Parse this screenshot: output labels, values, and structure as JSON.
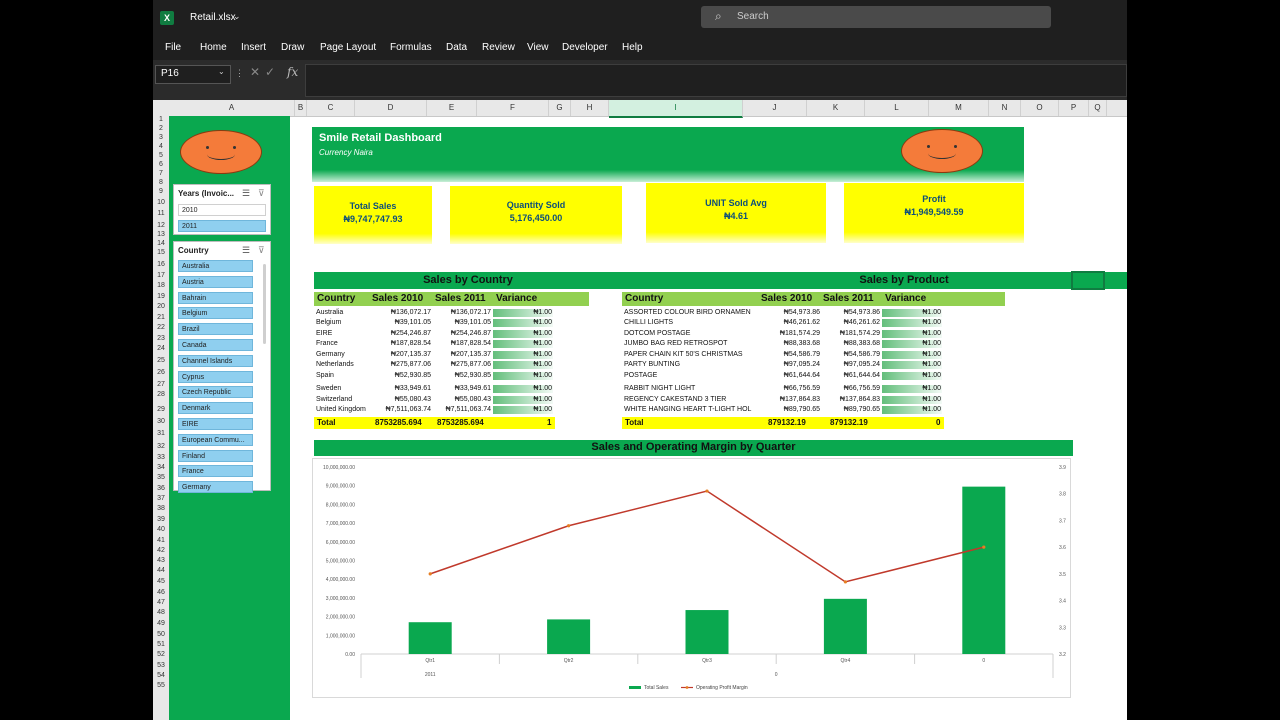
{
  "app": {
    "filename": "Retail.xlsx",
    "search_placeholder": "Search",
    "menu": [
      "File",
      "Home",
      "Insert",
      "Draw",
      "Page Layout",
      "Formulas",
      "Data",
      "Review",
      "View",
      "Developer",
      "Help"
    ],
    "name_box": "P16",
    "fx_label": "fx",
    "columns": [
      {
        "label": "A"
      },
      {
        "label": "B"
      },
      {
        "label": "C"
      },
      {
        "label": "D"
      },
      {
        "label": "E"
      },
      {
        "label": "F"
      },
      {
        "label": "G"
      },
      {
        "label": "H"
      },
      {
        "label": "I",
        "selected": true
      },
      {
        "label": "J"
      },
      {
        "label": "K"
      },
      {
        "label": "L"
      },
      {
        "label": "M"
      },
      {
        "label": "N"
      },
      {
        "label": "O"
      },
      {
        "label": "P"
      },
      {
        "label": "Q"
      }
    ],
    "rows": [
      "1",
      "2",
      "3",
      "4",
      "5",
      "6",
      "7",
      "8",
      "9",
      "10",
      "11",
      "12",
      "13",
      "14",
      "15",
      "16",
      "17",
      "18",
      "19",
      "20",
      "21",
      "22",
      "23",
      "24",
      "25",
      "26",
      "27",
      "28",
      "29",
      "30",
      "31",
      "32",
      "33",
      "34",
      "35",
      "36",
      "37",
      "38",
      "39",
      "40",
      "41",
      "42",
      "43",
      "44",
      "45",
      "46",
      "47",
      "48",
      "49",
      "50",
      "51",
      "52",
      "53",
      "54",
      "55"
    ]
  },
  "slicer_years": {
    "title": "Years (Invoic...",
    "items": [
      {
        "label": "2010",
        "selected": false
      },
      {
        "label": "2011",
        "selected": true
      }
    ]
  },
  "slicer_country": {
    "title": "Country",
    "items": [
      "Australia",
      "Austria",
      "Bahrain",
      "Belgium",
      "Brazil",
      "Canada",
      "Channel Islands",
      "Cyprus",
      "Czech Republic",
      "Denmark",
      "EIRE",
      "European Commu...",
      "Finland",
      "France",
      "Germany"
    ]
  },
  "dashboard": {
    "title": "Smile Retail Dashboard",
    "subtitle": "Currency Naira",
    "kpis": [
      {
        "label": "Total Sales",
        "value": "₦9,747,747.93"
      },
      {
        "label": "Quantity Sold",
        "value": "5,176,450.00"
      },
      {
        "label": "UNIT Sold Avg",
        "value": "₦4.61"
      },
      {
        "label": "Profit",
        "value": "₦1,949,549.59"
      }
    ]
  },
  "sales_by_country": {
    "title": "Sales by Country",
    "headers": [
      "Country",
      "Sales 2010",
      "Sales 2011",
      "Variance"
    ],
    "rows": [
      {
        "country": "Australia",
        "s2010": "₦136,072.17",
        "s2011": "₦136,072.17",
        "variance": "₦1.00"
      },
      {
        "country": "Belgium",
        "s2010": "₦39,101.05",
        "s2011": "₦39,101.05",
        "variance": "₦1.00"
      },
      {
        "country": "EIRE",
        "s2010": "₦254,246.87",
        "s2011": "₦254,246.87",
        "variance": "₦1.00"
      },
      {
        "country": "France",
        "s2010": "₦187,828.54",
        "s2011": "₦187,828.54",
        "variance": "₦1.00"
      },
      {
        "country": "Germany",
        "s2010": "₦207,135.37",
        "s2011": "₦207,135.37",
        "variance": "₦1.00"
      },
      {
        "country": "Netherlands",
        "s2010": "₦275,877.06",
        "s2011": "₦275,877.06",
        "variance": "₦1.00"
      },
      {
        "country": "Spain",
        "s2010": "₦52,930.85",
        "s2011": "₦52,930.85",
        "variance": "₦1.00"
      },
      {
        "country": "Sweden",
        "s2010": "₦33,949.61",
        "s2011": "₦33,949.61",
        "variance": "₦1.00"
      },
      {
        "country": "Switzerland",
        "s2010": "₦55,080.43",
        "s2011": "₦55,080.43",
        "variance": "₦1.00"
      },
      {
        "country": "United Kingdom",
        "s2010": "₦7,511,063.74",
        "s2011": "₦7,511,063.74",
        "variance": "₦1.00"
      }
    ],
    "total": {
      "label": "Total",
      "s2010": "8753285.694",
      "s2011": "8753285.694",
      "variance": "1"
    }
  },
  "sales_by_product": {
    "title": "Sales by Product",
    "headers": [
      "Country",
      "Sales 2010",
      "Sales 2011",
      "Variance"
    ],
    "rows": [
      {
        "product": "ASSORTED COLOUR BIRD ORNAMEN",
        "s2010": "₦54,973.86",
        "s2011": "₦54,973.86",
        "variance": "₦1.00"
      },
      {
        "product": "CHILLI LIGHTS",
        "s2010": "₦46,261.62",
        "s2011": "₦46,261.62",
        "variance": "₦1.00"
      },
      {
        "product": "DOTCOM POSTAGE",
        "s2010": "₦181,574.29",
        "s2011": "₦181,574.29",
        "variance": "₦1.00"
      },
      {
        "product": "JUMBO BAG RED RETROSPOT",
        "s2010": "₦88,383.68",
        "s2011": "₦88,383.68",
        "variance": "₦1.00"
      },
      {
        "product": "PAPER CHAIN KIT 50'S CHRISTMAS",
        "s2010": "₦54,586.79",
        "s2011": "₦54,586.79",
        "variance": "₦1.00"
      },
      {
        "product": "PARTY BUNTING",
        "s2010": "₦97,095.24",
        "s2011": "₦97,095.24",
        "variance": "₦1.00"
      },
      {
        "product": "POSTAGE",
        "s2010": "₦61,644.64",
        "s2011": "₦61,644.64",
        "variance": "₦1.00"
      },
      {
        "product": "RABBIT NIGHT LIGHT",
        "s2010": "₦66,756.59",
        "s2011": "₦66,756.59",
        "variance": "₦1.00"
      },
      {
        "product": "REGENCY CAKESTAND 3 TIER",
        "s2010": "₦137,864.83",
        "s2011": "₦137,864.83",
        "variance": "₦1.00"
      },
      {
        "product": "WHITE HANGING HEART T-LIGHT HOL",
        "s2010": "₦89,790.65",
        "s2011": "₦89,790.65",
        "variance": "₦1.00"
      }
    ],
    "total": {
      "label": "Total",
      "s2010": "879132.19",
      "s2011": "879132.19",
      "variance": "0"
    }
  },
  "chart_data": {
    "type": "bar",
    "title": "Sales and Operating Margin by Quarter",
    "categories": [
      "Qtr1",
      "Qtr2",
      "Qtr3",
      "Qtr4",
      "0"
    ],
    "group_labels": [
      "2011",
      "0"
    ],
    "series": [
      {
        "name": "Total Sales",
        "type": "bar",
        "axis": "left",
        "values": [
          1700000,
          1850000,
          2350000,
          2950000,
          8950000
        ]
      },
      {
        "name": "Operating Profit Margin",
        "type": "line",
        "axis": "right",
        "values": [
          3.5,
          3.68,
          3.81,
          3.47,
          3.6
        ]
      }
    ],
    "y_left_ticks": [
      "0.00",
      "1,000,000.00",
      "2,000,000.00",
      "3,000,000.00",
      "4,000,000.00",
      "5,000,000.00",
      "6,000,000.00",
      "7,000,000.00",
      "8,000,000.00",
      "9,000,000.00",
      "10,000,000.00"
    ],
    "ylim_left": [
      0,
      10000000
    ],
    "y_right_ticks": [
      "3.2",
      "3.3",
      "3.4",
      "3.5",
      "3.6",
      "3.7",
      "3.8",
      "3.9"
    ],
    "ylim_right": [
      3.2,
      3.9
    ],
    "colors": {
      "bar": "#0aa84f",
      "line": "#c0392b"
    },
    "legend": "bottom"
  }
}
